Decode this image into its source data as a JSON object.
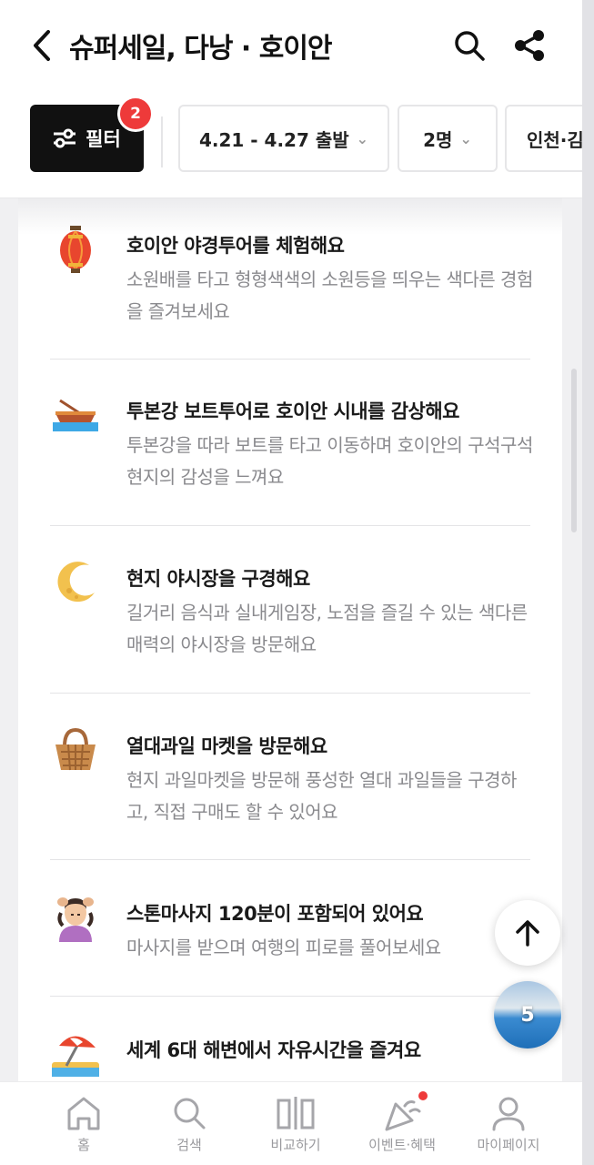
{
  "header": {
    "title": "슈퍼세일, 다낭 · 호이안"
  },
  "filters": {
    "filter_label": "필터",
    "filter_count": "2",
    "date_label": "4.21 - 4.27 출발",
    "people_label": "2명",
    "departure_label": "인천·김"
  },
  "items": [
    {
      "icon": "lantern-icon",
      "title": "호이안 야경투어를 체험해요",
      "desc": "소원배를 타고 형형색색의 소원등을 띄우는 색다른 경험을 즐겨보세요"
    },
    {
      "icon": "rowboat-icon",
      "title": "투본강 보트투어로 호이안 시내를 감상해요",
      "desc": "투본강을 따라 보트를 타고 이동하며 호이안의 구석구석 현지의 감성을 느껴요"
    },
    {
      "icon": "crescent-moon-icon",
      "title": "현지 야시장을 구경해요",
      "desc": "길거리 음식과 실내게임장, 노점을 즐길 수 있는 색다른 매력의 야시장을 방문해요"
    },
    {
      "icon": "basket-icon",
      "title": "열대과일 마켓을 방문해요",
      "desc": "현지 과일마켓을 방문해 풍성한 열대 과일들을 구경하고, 직접 구매도 할 수 있어요"
    },
    {
      "icon": "massage-icon",
      "title": "스톤마사지 120분이 포함되어 있어요",
      "desc": "마사지를 받으며 여행의 피로를 풀어보세요"
    },
    {
      "icon": "beach-umbrella-icon",
      "title": "세계 6대 해변에서 자유시간을 즐겨요",
      "desc": ""
    }
  ],
  "floating": {
    "recent_count": "5"
  },
  "nav": [
    {
      "label": "홈",
      "icon": "home-icon"
    },
    {
      "label": "검색",
      "icon": "search-icon"
    },
    {
      "label": "비교하기",
      "icon": "compare-icon"
    },
    {
      "label": "이벤트·혜택",
      "icon": "party-popper-icon"
    },
    {
      "label": "마이페이지",
      "icon": "person-icon"
    }
  ],
  "colors": {
    "accent_red": "#ee3a3a",
    "filter_bg": "#111111",
    "text_muted": "#8a8a8e"
  }
}
